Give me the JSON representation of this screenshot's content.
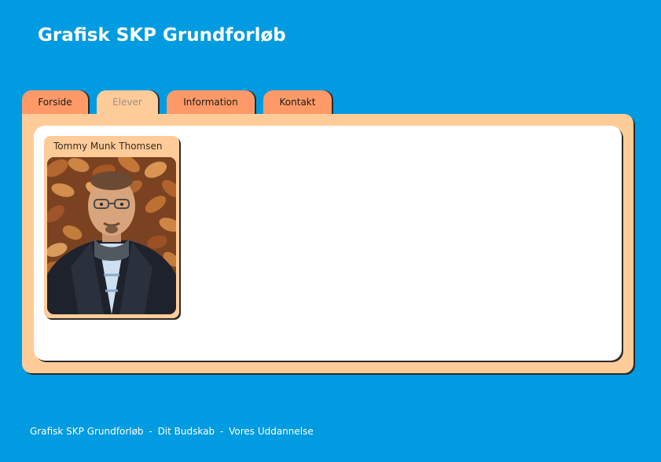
{
  "site": {
    "title": "Grafisk SKP Grundforløb"
  },
  "nav": {
    "tabs": [
      {
        "label": "Forside",
        "active": false
      },
      {
        "label": "Elever",
        "active": true
      },
      {
        "label": "Information",
        "active": false
      },
      {
        "label": "Kontakt",
        "active": false
      }
    ]
  },
  "students": [
    {
      "name": "Tommy Munk Thomsen",
      "photo_icon": "student-photo"
    }
  ],
  "footer": {
    "site_name": "Grafisk SKP Grundforløb",
    "separator": "-",
    "link_1": "Dit Budskab",
    "link_2": "Vores Uddannelse"
  },
  "colors": {
    "background": "#009be0",
    "tab": "#ff9a68",
    "tab_active": "#ffcc99",
    "panel": "#ffcc99",
    "content": "#ffffff"
  }
}
